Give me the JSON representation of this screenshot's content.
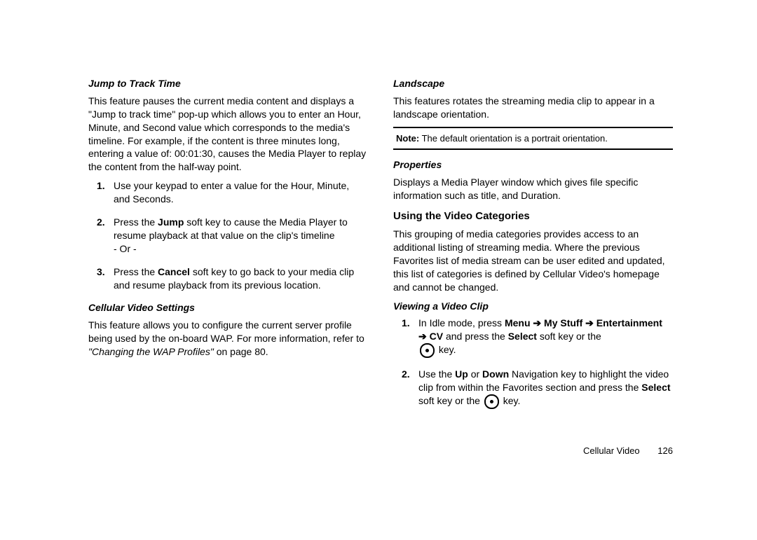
{
  "left": {
    "jump": {
      "heading": "Jump to Track Time",
      "para": "This feature pauses the current media content and displays a \"Jump to track time\" pop-up which allows you to enter an Hour, Minute, and Second value which corresponds to the media's timeline. For example, if the content is three minutes long, entering a value of: 00:01:30, causes the Media Player to replay the content from the half-way point.",
      "items": [
        "Use your keypad to enter a value for the Hour, Minute, and Seconds.",
        {
          "pre": "Press the ",
          "b1": "Jump",
          "post": " soft key to cause the Media Player to resume playback at that value on the clip's timeline",
          "or": "- Or -"
        },
        {
          "pre": "Press the ",
          "b1": "Cancel",
          "post": " soft key to go back to your media clip and resume playback from its previous location."
        }
      ]
    },
    "cvs": {
      "heading": "Cellular Video Settings",
      "para_pre": "This feature allows you to configure the current server profile being used by the on-board WAP. For more information, refer to ",
      "ref": "\"Changing the WAP Profiles\" ",
      "para_post": " on page 80."
    }
  },
  "right": {
    "landscape": {
      "heading": "Landscape",
      "para": "This features rotates the streaming media clip to appear in a landscape orientation.",
      "note_label": "Note:",
      "note_text": " The default orientation is a portrait orientation."
    },
    "properties": {
      "heading": "Properties",
      "para": "Displays a Media Player window which gives file specific information such as title, and Duration."
    },
    "categories": {
      "heading": "Using the Video Categories",
      "para": "This grouping of media categories provides access to an additional listing of streaming media. Where the previous Favorites list of media stream can be user edited and updated, this list of categories is defined by Cellular Video's homepage and cannot be changed."
    },
    "viewing": {
      "heading": "Viewing a Video Clip",
      "item1": {
        "pre": "In Idle mode, press ",
        "menu": "Menu",
        "arrow": " ➔ ",
        "mystuff": "My Stuff",
        "ent": "Entertainment",
        "cv": "CV",
        "mid": " and press the ",
        "select": "Select",
        "post1": " soft key or the",
        "post2": " key."
      },
      "item2": {
        "pre": "Use the ",
        "up": "Up",
        "or": " or ",
        "down": "Down",
        "mid": " Navigation key to highlight the video clip from within the Favorites section and press the ",
        "select": "Select",
        "post1": " soft key or the ",
        "post2": " key."
      }
    }
  },
  "footer": {
    "section": "Cellular Video",
    "page": "126"
  }
}
